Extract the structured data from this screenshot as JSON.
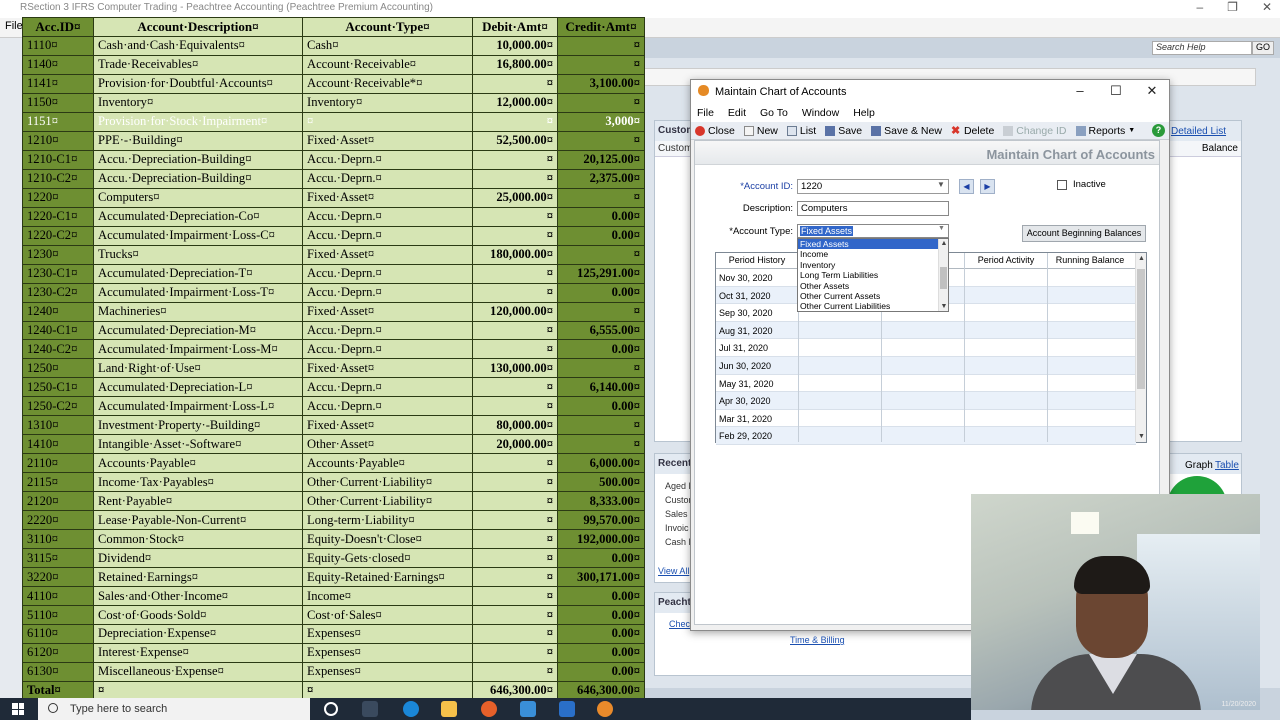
{
  "app": {
    "title": "RSection 3 IFRS Computer Trading - Peachtree Accounting (Peachtree Premium Accounting)",
    "menu_file": "File",
    "search_placeholder": "Search Help",
    "go_label": "GO"
  },
  "background": {
    "customer_panel_title": "Custom",
    "customer_sub": "Custom",
    "balance_label": "Balance",
    "detailed_list": "Detailed List",
    "recent_title": "Recent",
    "recent_items": [
      "Aged R",
      "Custon",
      "Sales J",
      "Invoic",
      "Cash R"
    ],
    "view_all": "View All",
    "graph_label": "Graph",
    "table_label": "Table",
    "peachtree_title": "Peacht",
    "check_label": "Check",
    "time_billing": "Time & Billing"
  },
  "sheet": {
    "headers": [
      "Acc.ID¤",
      "Account·Description¤",
      "Account·Type¤",
      "Debit·Amt¤",
      "Credit·Amt¤"
    ],
    "rows": [
      [
        "1110¤",
        "Cash·and·Cash·Equivalents¤",
        "Cash¤",
        "10,000.00¤",
        "¤"
      ],
      [
        "1140¤",
        "Trade·Receivables¤",
        "Account·Receivable¤",
        "16,800.00¤",
        "¤"
      ],
      [
        "1141¤",
        "Provision·for·Doubtful·Accounts¤",
        "Account·Receivable*¤",
        "¤",
        "3,100.00¤"
      ],
      [
        "1150¤",
        "Inventory¤",
        "Inventory¤",
        "12,000.00¤",
        "¤"
      ],
      [
        "1151¤",
        "Provision·for·Stock·Impairment¤",
        "¤",
        "¤",
        "3,000¤"
      ],
      [
        "1210¤",
        "PPE·-·Building¤",
        "Fixed·Asset¤",
        "52,500.00¤",
        "¤"
      ],
      [
        "1210-C1¤",
        "Accu.·Depreciation-Building¤",
        "Accu.·Deprn.¤",
        "¤",
        "20,125.00¤"
      ],
      [
        "1210-C2¤",
        "Accu.·Depreciation-Building¤",
        "Accu.·Deprn.¤",
        "¤",
        "2,375.00¤"
      ],
      [
        "1220¤",
        "Computers¤",
        "Fixed·Asset¤",
        "25,000.00¤",
        "¤"
      ],
      [
        "1220-C1¤",
        "Accumulated·Depreciation-Co¤",
        "Accu.·Deprn.¤",
        "¤",
        "0.00¤"
      ],
      [
        "1220-C2¤",
        "Accumulated·Impairment·Loss-C¤",
        "Accu.·Deprn.¤",
        "¤",
        "0.00¤"
      ],
      [
        "1230¤",
        "Trucks¤",
        "Fixed·Asset¤",
        "180,000.00¤",
        "¤"
      ],
      [
        "1230-C1¤",
        "Accumulated·Depreciation-T¤",
        "Accu.·Deprn.¤",
        "¤",
        "125,291.00¤"
      ],
      [
        "1230-C2¤",
        "Accumulated·Impairment·Loss-T¤",
        "Accu.·Deprn.¤",
        "¤",
        "0.00¤"
      ],
      [
        "1240¤",
        "Machineries¤",
        "Fixed·Asset¤",
        "120,000.00¤",
        "¤"
      ],
      [
        "1240-C1¤",
        "Accumulated·Depreciation-M¤",
        "Accu.·Deprn.¤",
        "¤",
        "6,555.00¤"
      ],
      [
        "1240-C2¤",
        "Accumulated·Impairment·Loss-M¤",
        "Accu.·Deprn.¤",
        "¤",
        "0.00¤"
      ],
      [
        "1250¤",
        "Land·Right·of·Use¤",
        "Fixed·Asset¤",
        "130,000.00¤",
        "¤"
      ],
      [
        "1250-C1¤",
        "Accumulated·Depreciation-L¤",
        "Accu.·Deprn.¤",
        "¤",
        "6,140.00¤"
      ],
      [
        "1250-C2¤",
        "Accumulated·Impairment·Loss-L¤",
        "Accu.·Deprn.¤",
        "¤",
        "0.00¤"
      ],
      [
        "1310¤",
        "Investment·Property·-Building¤",
        "Fixed·Asset¤",
        "80,000.00¤",
        "¤"
      ],
      [
        "1410¤",
        "Intangible·Asset·-Software¤",
        "Other·Asset¤",
        "20,000.00¤",
        "¤"
      ],
      [
        "2110¤",
        "Accounts·Payable¤",
        "Accounts·Payable¤",
        "¤",
        "6,000.00¤"
      ],
      [
        "2115¤",
        "Income·Tax·Payables¤",
        "Other·Current·Liability¤",
        "¤",
        "500.00¤"
      ],
      [
        "2120¤",
        "Rent·Payable¤",
        "Other·Current·Liability¤",
        "¤",
        "8,333.00¤"
      ],
      [
        "2220¤",
        "Lease·Payable-Non-Current¤",
        "Long-term·Liability¤",
        "¤",
        "99,570.00¤"
      ],
      [
        "3110¤",
        "Common·Stock¤",
        "Equity-Doesn't·Close¤",
        "¤",
        "192,000.00¤"
      ],
      [
        "3115¤",
        "Dividend¤",
        "Equity-Gets·closed¤",
        "¤",
        "0.00¤"
      ],
      [
        "3220¤",
        "Retained·Earnings¤",
        "Equity-Retained·Earnings¤",
        "¤",
        "300,171.00¤"
      ],
      [
        "4110¤",
        "Sales·and·Other·Income¤",
        "Income¤",
        "¤",
        "0.00¤"
      ],
      [
        "5110¤",
        "Cost·of·Goods·Sold¤",
        "Cost·of·Sales¤",
        "¤",
        "0.00¤"
      ],
      [
        "6110¤",
        "Depreciation·Expense¤",
        "Expenses¤",
        "¤",
        "0.00¤"
      ],
      [
        "6120¤",
        "Interest·Expense¤",
        "Expenses¤",
        "¤",
        "0.00¤"
      ],
      [
        "6130¤",
        "Miscellaneous·Expense¤",
        "Expenses¤",
        "¤",
        "0.00¤"
      ]
    ],
    "total_row": [
      "Total¤",
      "¤",
      "¤",
      "646,300.00¤",
      "646,300.00¤"
    ]
  },
  "dialog": {
    "title": "Maintain Chart of Accounts",
    "menu": [
      "File",
      "Edit",
      "Go To",
      "Window",
      "Help"
    ],
    "toolbar": {
      "close": "Close",
      "new": "New",
      "list": "List",
      "save": "Save",
      "save_new": "Save & New",
      "delete": "Delete",
      "change_id": "Change ID",
      "reports": "Reports"
    },
    "header_title": "Maintain Chart of Accounts",
    "account_id_label": "*Account ID:",
    "account_id_value": "1220",
    "inactive_label": "Inactive",
    "description_label": "Description:",
    "description_value": "Computers",
    "account_type_label": "*Account Type:",
    "account_type_value": "Fixed Assets",
    "beginning_balances_button": "Account Beginning Balances",
    "type_options": [
      "Fixed Assets",
      "Income",
      "Inventory",
      "Long Term Liabilities",
      "Other Assets",
      "Other Current Assets",
      "Other Current Liabilities"
    ],
    "history_headers": {
      "period_history": "Period History",
      "period_activity": "Period Activity",
      "running_balance": "Running Balance"
    },
    "history_rows": [
      "Nov 30, 2020",
      "Oct 31, 2020",
      "Sep 30, 2020",
      "Aug 31, 2020",
      "Jul 31, 2020",
      "Jun 30, 2020",
      "May 31, 2020",
      "Apr 30, 2020",
      "Mar 31, 2020",
      "Feb 29, 2020"
    ]
  },
  "taskbar": {
    "search_placeholder": "Type here to search"
  },
  "webcam": {
    "date": "11/20/2020"
  }
}
